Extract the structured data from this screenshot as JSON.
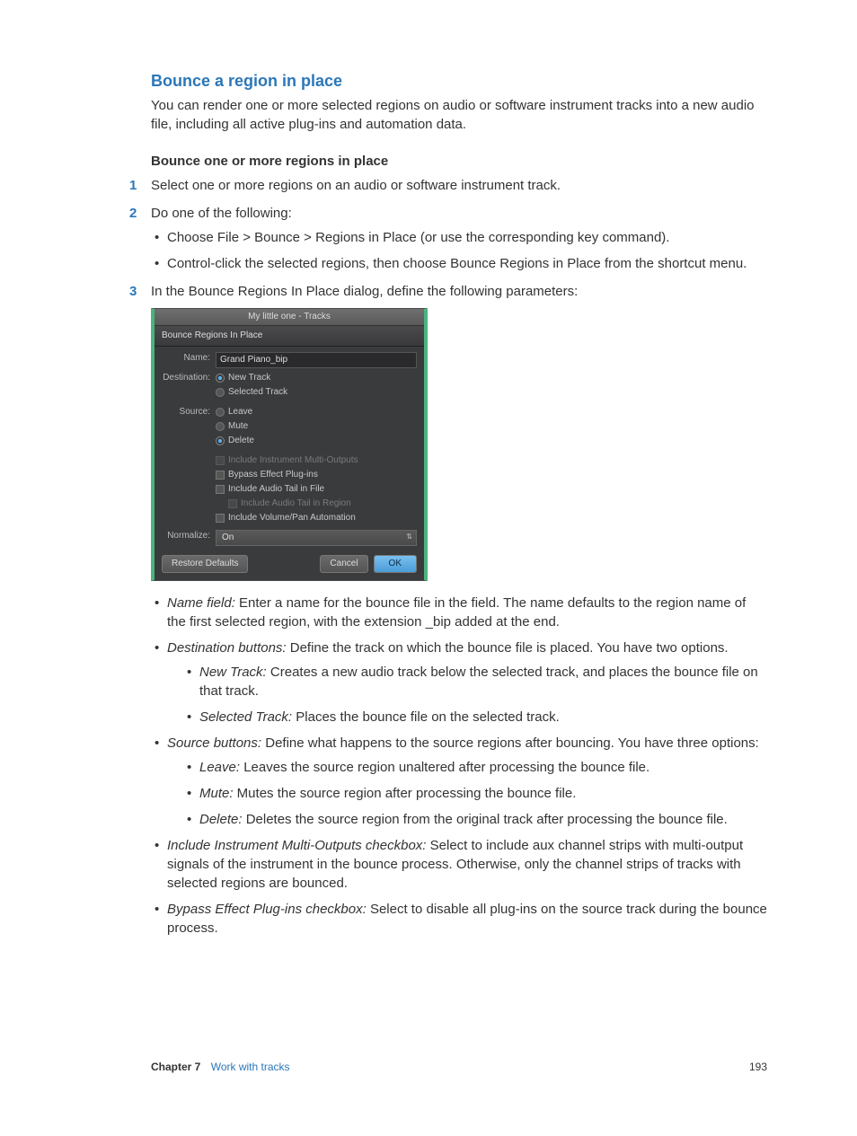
{
  "heading": "Bounce a region in place",
  "intro": "You can render one or more selected regions on audio or software instrument tracks into a new audio file, including all active plug-ins and automation data.",
  "subhead": "Bounce one or more regions in place",
  "step1": "Select one or more regions on an audio or software instrument track.",
  "step2": "Do one of the following:",
  "step2_b1": "Choose File > Bounce > Regions in Place (or use the corresponding key command).",
  "step2_b2": "Control-click the selected regions, then choose Bounce Regions in Place from the shortcut menu.",
  "step3": "In the Bounce Regions In Place dialog, define the following parameters:",
  "dialog": {
    "window_title": "My little one - Tracks",
    "subtitle": "Bounce Regions In Place",
    "name_label": "Name:",
    "name_value": "Grand Piano_bip",
    "dest_label": "Destination:",
    "dest_new": "New Track",
    "dest_sel": "Selected Track",
    "src_label": "Source:",
    "src_leave": "Leave",
    "src_mute": "Mute",
    "src_delete": "Delete",
    "chk_multi": "Include Instrument Multi-Outputs",
    "chk_bypass": "Bypass Effect Plug-ins",
    "chk_tailfile": "Include Audio Tail in File",
    "chk_tailreg": "Include Audio Tail in Region",
    "chk_vol": "Include Volume/Pan Automation",
    "norm_label": "Normalize:",
    "norm_value": "On",
    "restore": "Restore Defaults",
    "cancel": "Cancel",
    "ok": "OK"
  },
  "params": {
    "name_label": "Name field:",
    "name_text": " Enter a name for the bounce file in the field. The name defaults to the region name of the first selected region, with the extension _bip added at the end.",
    "dest_label": "Destination buttons:",
    "dest_text": " Define the track on which the bounce file is placed. You have two options.",
    "dest_new_label": "New Track:",
    "dest_new_text": " Creates a new audio track below the selected track, and places the bounce file on that track.",
    "dest_sel_label": "Selected Track:",
    "dest_sel_text": " Places the bounce file on the selected track.",
    "src_label": "Source buttons:",
    "src_text": " Define what happens to the source regions after bouncing. You have three options:",
    "src_leave_label": "Leave:",
    "src_leave_text": " Leaves the source region unaltered after processing the bounce file.",
    "src_mute_label": "Mute:",
    "src_mute_text": " Mutes the source region after processing the bounce file.",
    "src_delete_label": "Delete:",
    "src_delete_text": " Deletes the source region from the original track after processing the bounce file.",
    "multi_label": "Include Instrument Multi-Outputs checkbox:",
    "multi_text": " Select to include aux channel strips with multi-output signals of the instrument in the bounce process. Otherwise, only the channel strips of tracks with selected regions are bounced.",
    "bypass_label": "Bypass Effect Plug-ins checkbox:",
    "bypass_text": " Select to disable all plug-ins on the source track during the bounce process."
  },
  "footer": {
    "chapter": "Chapter  7",
    "title": "Work with tracks",
    "page": "193"
  }
}
